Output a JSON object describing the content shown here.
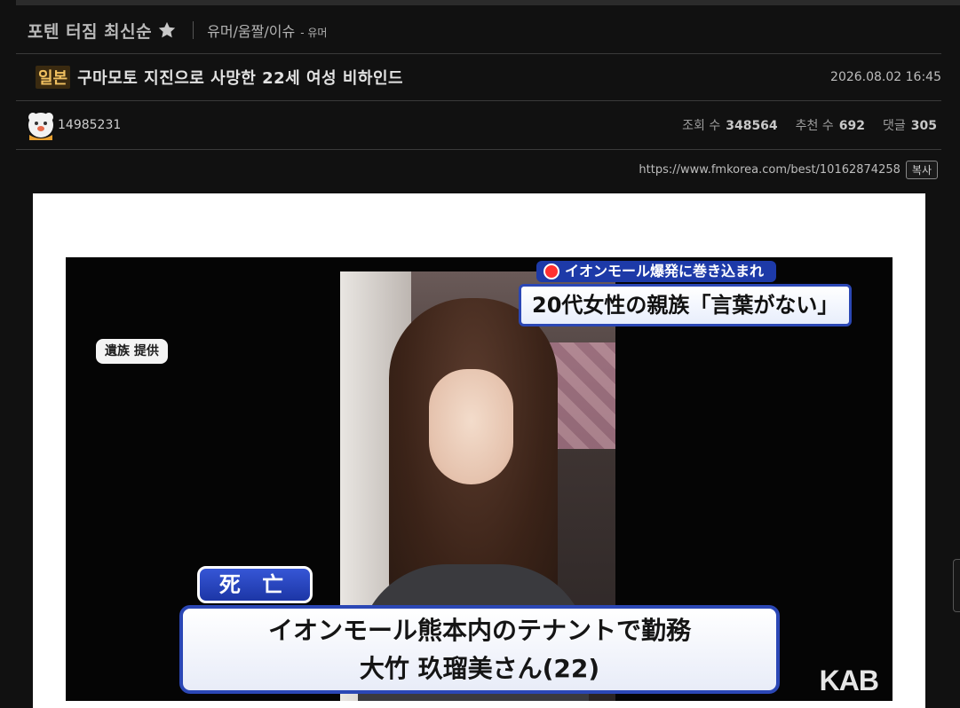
{
  "board": {
    "title": "포텐 터짐 최신순",
    "category": "유머/움짤/이슈",
    "subcategory": "- 유머"
  },
  "post": {
    "tag": "일본",
    "title": "구마모토 지진으로 사망한 22세 여성 비하인드",
    "date": "2026.08.02 16:45",
    "author": "14985231",
    "stats": {
      "views_label": "조회 수",
      "views": "348564",
      "recommend_label": "추천 수",
      "recommend": "692",
      "comments_label": "댓글",
      "comments": "305"
    },
    "url": "https://www.fmkorea.com/best/10162874258",
    "copy_label": "복사"
  },
  "image": {
    "top_caption_small": "イオンモール爆発に巻き込まれ",
    "top_caption_main": "20代女性の親族「言葉がない」",
    "credit": "遺族 提供",
    "death_label": "死 亡",
    "main_caption_line1": "イオンモール熊本内のテナントで勤務",
    "main_caption_line2": "大竹 玖瑠美さん(22)",
    "logo": "KAB"
  },
  "colors": {
    "background": "#111111",
    "tag_text": "#f0c060",
    "caption_blue": "#2b47b5"
  }
}
